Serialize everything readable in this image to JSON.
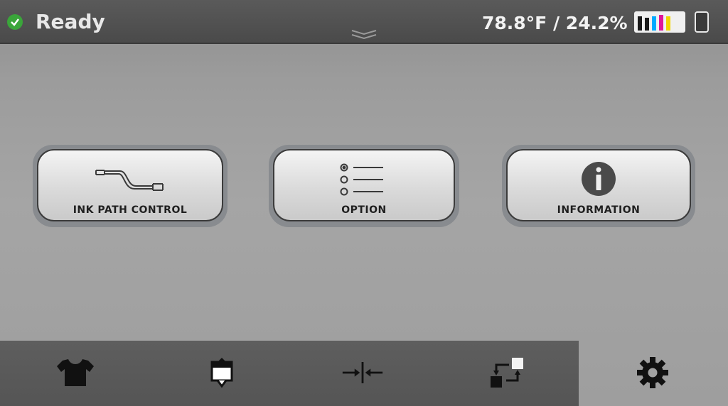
{
  "status": {
    "state": "Ready",
    "environment": "78.8°F / 24.2%",
    "ink_colors": [
      "#1a1a1a",
      "#1a1a1a",
      "#00aaff",
      "#e0169a",
      "#f2d500"
    ],
    "ok_color": "#3aa63a"
  },
  "menu": {
    "buttons": [
      {
        "label": "INK PATH CONTROL",
        "icon": "ink-path-icon"
      },
      {
        "label": "OPTION",
        "icon": "option-list-icon"
      },
      {
        "label": "INFORMATION",
        "icon": "info-icon"
      }
    ]
  },
  "tabs": [
    {
      "icon": "tshirt-icon"
    },
    {
      "icon": "print-head-icon"
    },
    {
      "icon": "align-icon"
    },
    {
      "icon": "swap-icon"
    },
    {
      "icon": "gear-icon"
    }
  ]
}
